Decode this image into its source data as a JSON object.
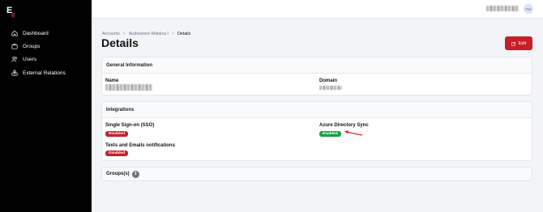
{
  "app": {
    "logo_text": "E",
    "logo_subtext": "g"
  },
  "sidebar": {
    "items": [
      {
        "label": "Dashboard",
        "icon": "home-icon"
      },
      {
        "label": "Groups",
        "icon": "briefcase-icon"
      },
      {
        "label": "Users",
        "icon": "users-icon"
      },
      {
        "label": "External Relations",
        "icon": "external-relations-icon"
      }
    ]
  },
  "header": {
    "avatar_initials": "YW"
  },
  "breadcrumb": {
    "items": [
      "Accounts",
      "Audreanne Watsica I",
      "Details"
    ]
  },
  "page": {
    "title": "Details",
    "edit_label": "Edit"
  },
  "general": {
    "title": "General Information",
    "name_label": "Name",
    "domain_label": "Domain"
  },
  "integrations": {
    "title": "Integrations",
    "sso_label": "Single Sign-on (SSO)",
    "sso_status": "Disabled",
    "azure_label": "Azure Directory Sync",
    "azure_status": "Enabled",
    "texts_label": "Texts and Emails notifications",
    "texts_status": "Disabled"
  },
  "groups": {
    "label": "Groups(s)",
    "count": "3"
  },
  "colors": {
    "accent": "#c81e2a",
    "enabled": "#16a34a",
    "sidebar": "#000000"
  }
}
